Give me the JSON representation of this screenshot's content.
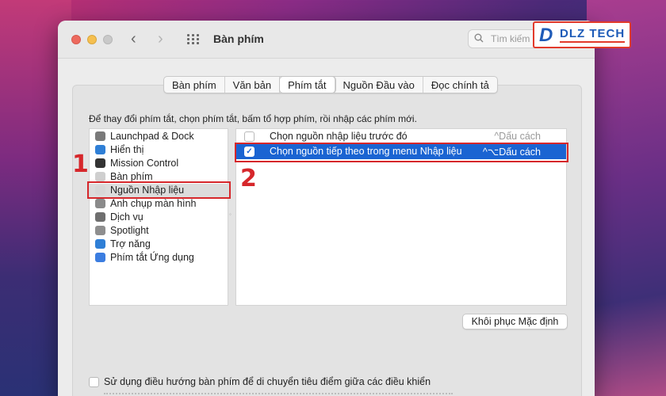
{
  "window": {
    "title": "Bàn phím",
    "search_placeholder": "Tìm kiếm"
  },
  "watermark": {
    "letter": "D",
    "text": "DLZ TECH"
  },
  "tabs": [
    {
      "label": "Bàn phím",
      "active": false
    },
    {
      "label": "Văn bản",
      "active": false
    },
    {
      "label": "Phím tắt",
      "active": true
    },
    {
      "label": "Nguồn Đầu vào",
      "active": false
    },
    {
      "label": "Đọc chính tả",
      "active": false
    }
  ],
  "instruction": "Để thay đổi phím tắt, chọn phím tắt, bấm tổ hợp phím, rồi nhập các phím mới.",
  "categories": [
    {
      "label": "Launchpad & Dock",
      "icon": "launchpad-icon",
      "color": "#7a7a7a"
    },
    {
      "label": "Hiển thị",
      "icon": "display-icon",
      "color": "#2f7fd6"
    },
    {
      "label": "Mission Control",
      "icon": "mission-control-icon",
      "color": "#333333"
    },
    {
      "label": "Bàn phím",
      "icon": "keyboard-icon",
      "color": "#cfcfcf"
    },
    {
      "label": "Nguồn Nhập liệu",
      "icon": "input-source-icon",
      "color": "#d7d7d7"
    },
    {
      "label": "Ảnh chụp màn hình",
      "icon": "screenshot-icon",
      "color": "#8a8a8a"
    },
    {
      "label": "Dịch vụ",
      "icon": "services-icon",
      "color": "#6f6f6f"
    },
    {
      "label": "Spotlight",
      "icon": "spotlight-icon",
      "color": "#8e8e8e"
    },
    {
      "label": "Trợ năng",
      "icon": "accessibility-icon",
      "color": "#2f7fd6"
    },
    {
      "label": "Phím tắt Ứng dụng",
      "icon": "app-shortcuts-icon",
      "color": "#3b7de0"
    }
  ],
  "selected_category": "Nguồn Nhập liệu",
  "shortcuts": [
    {
      "checked": false,
      "label": "Chọn nguồn nhập liệu trước đó",
      "keys": "^Dấu cách"
    },
    {
      "checked": true,
      "label": "Chọn nguồn tiếp theo trong menu Nhập liệu",
      "keys": "^⌥Dấu cách"
    }
  ],
  "restore_button": "Khôi phục Mặc định",
  "bottom_option": {
    "checked": false,
    "label": "Sử dụng điều hướng bàn phím để di chuyển tiêu điểm giữa các điều khiển"
  },
  "annotations": [
    "1",
    "2"
  ],
  "colors": {
    "selection": "#1a64d2",
    "highlight": "#d6272b"
  }
}
